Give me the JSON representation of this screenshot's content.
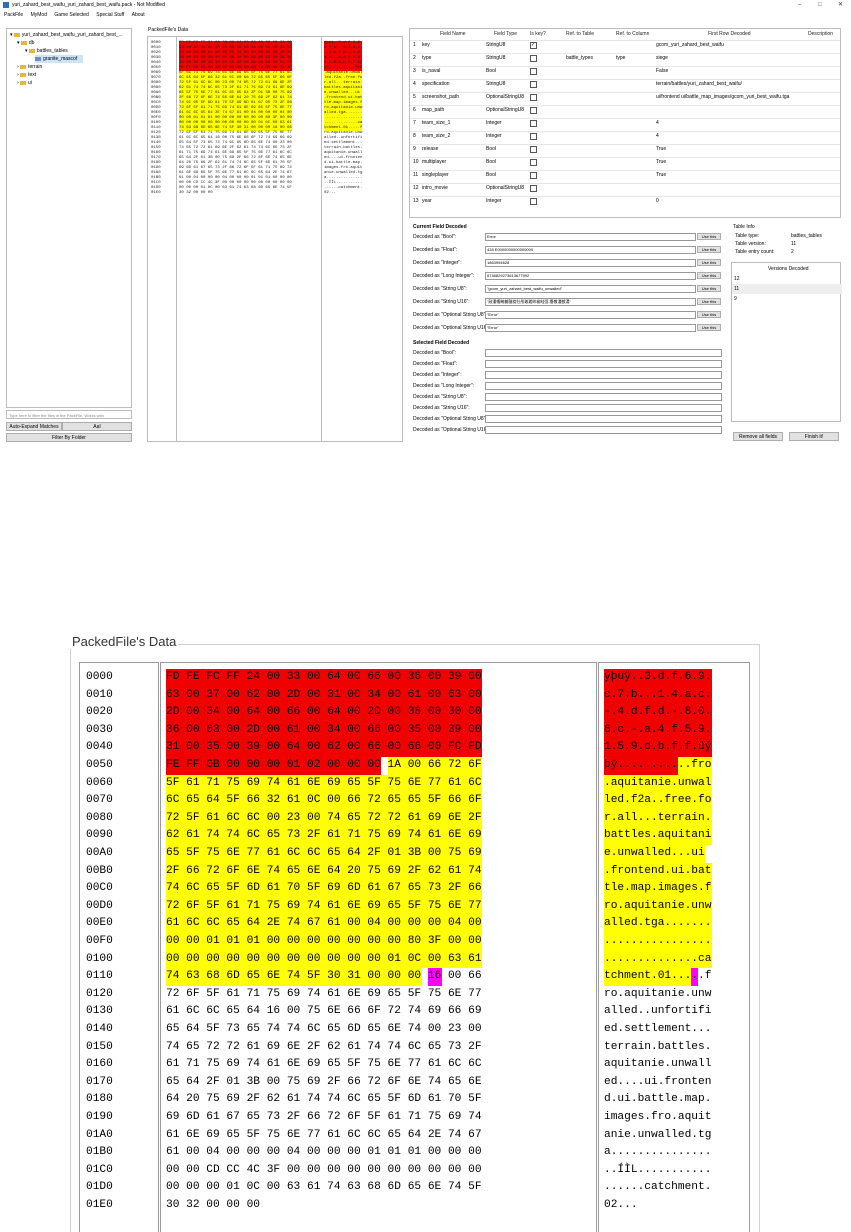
{
  "window": {
    "title": "yuri_zahard_best_waifu_yuri_zahard_best_waifu.pack - Not Modified",
    "minimize": "–",
    "maximize": "□",
    "close": "✕"
  },
  "menu": [
    "PackFile",
    "MyMod",
    "Game Selected",
    "Special Stuff",
    "About"
  ],
  "tree": {
    "root": "yuri_zahard_best_waifu_yuri_zahard_best_...",
    "items": [
      "db",
      "battles_tables",
      "granite_mascof",
      "terrain",
      "text",
      "ui"
    ],
    "filter_placeholder": "Type here to filter the files in the PackFile. Works with",
    "auto_expand_label": "Auto-Expand Matches",
    "case_label": "AaI",
    "filter_folder_label": "Filter By Folder"
  },
  "packed_small_label": "PackedFile's Data",
  "grid": {
    "headers": [
      "Field Name",
      "Field Type",
      "Is key?",
      "Ref. to Table",
      "Ref. to Column",
      "First Row Decoded",
      "Description"
    ],
    "rows": [
      {
        "n": "1",
        "name": "key",
        "type": "StringU8",
        "key": true,
        "ref_table": "",
        "ref_col": "",
        "first": "gcom_yuri_zahard_best_waifu"
      },
      {
        "n": "2",
        "name": "type",
        "type": "StringU8",
        "key": false,
        "ref_table": "battle_types",
        "ref_col": "type",
        "first": "siege"
      },
      {
        "n": "3",
        "name": "is_naval",
        "type": "Bool",
        "key": false,
        "ref_table": "",
        "ref_col": "",
        "first": "False"
      },
      {
        "n": "4",
        "name": "specification",
        "type": "StringU8",
        "key": false,
        "ref_table": "",
        "ref_col": "",
        "first": "terrain/battles/yuri_zahard_best_waifu/"
      },
      {
        "n": "5",
        "name": "screenshot_path",
        "type": "OptionalStringU8",
        "key": false,
        "ref_table": "",
        "ref_col": "",
        "first": "ui/frontend ui/battle_map_images/gcom_yuri_best_waifu.tga"
      },
      {
        "n": "6",
        "name": "map_path",
        "type": "OptionalStringU8",
        "key": false,
        "ref_table": "",
        "ref_col": "",
        "first": ""
      },
      {
        "n": "7",
        "name": "team_size_1",
        "type": "Integer",
        "key": false,
        "ref_table": "",
        "ref_col": "",
        "first": "4"
      },
      {
        "n": "8",
        "name": "team_size_2",
        "type": "Integer",
        "key": false,
        "ref_table": "",
        "ref_col": "",
        "first": "4"
      },
      {
        "n": "9",
        "name": "release",
        "type": "Bool",
        "key": false,
        "ref_table": "",
        "ref_col": "",
        "first": "True"
      },
      {
        "n": "10",
        "name": "multiplayer",
        "type": "Bool",
        "key": false,
        "ref_table": "",
        "ref_col": "",
        "first": "True"
      },
      {
        "n": "11",
        "name": "singleplayer",
        "type": "Bool",
        "key": false,
        "ref_table": "",
        "ref_col": "",
        "first": "True"
      },
      {
        "n": "12",
        "name": "intro_movie",
        "type": "OptionalStringU8",
        "key": false,
        "ref_table": "",
        "ref_col": "",
        "first": ""
      },
      {
        "n": "13",
        "name": "year",
        "type": "Integer",
        "key": false,
        "ref_table": "",
        "ref_col": "",
        "first": "0"
      }
    ]
  },
  "decoder": {
    "current_label": "Current Field Decoded",
    "current": [
      {
        "label": "Decoded as \"Bool\":",
        "value": "Error"
      },
      {
        "label": "Decoded as \"Float\":",
        "value": "428 E0000000000000000"
      },
      {
        "label": "Decoded as \"Integer\":",
        "value": "1863994628"
      },
      {
        "label": "Decoded as \"Long Integer\":",
        "value": "8746829273613677992"
      },
      {
        "label": "Decoded as \"String U8\":",
        "value": "\"gcom_yuri_zahard_best_waifu_unwalled\""
      },
      {
        "label": "Decoded as \"String U16\":",
        "value": "\"敲湩㡧畹楲穟桡牡彤敢瑳睟楡畦弳⸳㨱敬湩獣湯\""
      },
      {
        "label": "Decoded as \"Optional String U8\":",
        "value": "\"Error\""
      },
      {
        "label": "Decoded as \"Optional String U16\":",
        "value": "\"Error\""
      }
    ],
    "use_label": "Use this",
    "selected_label": "Selected Field Decoded",
    "selected": [
      "Decoded as \"Bool\":",
      "Decoded as \"Float\":",
      "Decoded as \"Integer\":",
      "Decoded as \"Long Integer\":",
      "Decoded as \"String U8\":",
      "Decoded as \"String U16\":",
      "Decoded as \"Optional String U8\":",
      "Decoded as \"Optional String U16\":"
    ]
  },
  "table_info": {
    "title": "Table Info",
    "type_label": "Table type:",
    "type_value": "battles_tables",
    "version_label": "Table version:",
    "version_value": "11",
    "count_label": "Table entry count:",
    "count_value": "2",
    "versions_title": "Versions Decoded",
    "versions": [
      "12",
      "11",
      "9"
    ],
    "remove_label": "Remove all fields",
    "finish_label": "Finish it!"
  },
  "zoom_title": "PackedFile's Data",
  "hex_lines": [
    {
      "off": "0000",
      "hex": "FD FE FC FF 24 00 33 00 64 00 66 00 36 00 39 00",
      "asc": "ýþüÿ..3.d.f.6.9."
    },
    {
      "off": "0010",
      "hex": "63 00 37 00 62 00 2D 00 31 00 34 00 61 00 63 00",
      "asc": "c.7.b...1.4.a.c."
    },
    {
      "off": "0020",
      "hex": "2D 00 34 00 64 00 66 00 64 00 2D 00 38 00 30 00",
      "asc": "-.4.d.f.d.-.8.0."
    },
    {
      "off": "0030",
      "hex": "36 00 63 00 2D 00 61 00 34 00 66 00 35 00 39 00",
      "asc": "6.c.-.a.4.f.5.9."
    },
    {
      "off": "0040",
      "hex": "31 00 35 00 39 00 64 00 62 00 66 00 66 00 FC FD",
      "asc": "1.5.9.d.b.f.f.üý"
    },
    {
      "off": "0050",
      "hex": "FE FF 0B 00 00 00 01 02 00 00 00 1A 00 66 72 6F",
      "asc": "þÿ...........fro"
    },
    {
      "off": "0060",
      "hex": "5F 61 71 75 69 74 61 6E 69 65 5F 75 6E 77 61 6C",
      "asc": ".aquitanie.unwal"
    },
    {
      "off": "0070",
      "hex": "6C 65 64 5F 66 32 61 0C 00 66 72 65 65 5F 66 6F",
      "asc": "led.f2a..free.fo"
    },
    {
      "off": "0080",
      "hex": "72 5F 61 6C 6C 00 23 00 74 65 72 72 61 69 6E 2F",
      "asc": "r.all...terrain."
    },
    {
      "off": "0090",
      "hex": "62 61 74 74 6C 65 73 2F 61 71 75 69 74 61 6E 69",
      "asc": "battles.aquitani"
    },
    {
      "off": "00A0",
      "hex": "65 5F 75 6E 77 61 6C 6C 65 64 2F 01 3B 00 75 69",
      "asc": "e.unwalled...ui"
    },
    {
      "off": "00B0",
      "hex": "2F 66 72 6F 6E 74 65 6E 64 20 75 69 2F 62 61 74",
      "asc": ".frontend.ui.bat"
    },
    {
      "off": "00C0",
      "hex": "74 6C 65 5F 6D 61 70 5F 69 6D 61 67 65 73 2F 66",
      "asc": "tle.map.images.f"
    },
    {
      "off": "00D0",
      "hex": "72 6F 5F 61 71 75 69 74 61 6E 69 65 5F 75 6E 77",
      "asc": "ro.aquitanie.unw"
    },
    {
      "off": "00E0",
      "hex": "61 6C 6C 65 64 2E 74 67 61 00 04 00 00 00 04 00",
      "asc": "alled.tga......."
    },
    {
      "off": "00F0",
      "hex": "00 00 01 01 01 00 00 00 00 00 00 00 80 3F 00 00",
      "asc": "................"
    },
    {
      "off": "0100",
      "hex": "00 00 00 00 00 00 00 00 00 00 00 01 0C 00 63 61",
      "asc": "..............ca"
    },
    {
      "off": "0110",
      "hex": "74 63 68 6D 65 6E 74 5F 30 31 00 00 00 16 00 66",
      "asc": "tchment.01.....f"
    },
    {
      "off": "0120",
      "hex": "72 6F 5F 61 71 75 69 74 61 6E 69 65 5F 75 6E 77",
      "asc": "ro.aquitanie.unw"
    },
    {
      "off": "0130",
      "hex": "61 6C 6C 65 64 16 00 75 6E 66 6F 72 74 69 66 69",
      "asc": "alled..unfortifi"
    },
    {
      "off": "0140",
      "hex": "65 64 5F 73 65 74 74 6C 65 6D 65 6E 74 00 23 00",
      "asc": "ed.settlement..."
    },
    {
      "off": "0150",
      "hex": "74 65 72 72 61 69 6E 2F 62 61 74 74 6C 65 73 2F",
      "asc": "terrain.battles."
    },
    {
      "off": "0160",
      "hex": "61 71 75 69 74 61 6E 69 65 5F 75 6E 77 61 6C 6C",
      "asc": "aquitanie.unwall"
    },
    {
      "off": "0170",
      "hex": "65 64 2F 01 3B 00 75 69 2F 66 72 6F 6E 74 65 6E",
      "asc": "ed....ui.fronten"
    },
    {
      "off": "0180",
      "hex": "64 20 75 69 2F 62 61 74 74 6C 65 5F 6D 61 70 5F",
      "asc": "d.ui.battle.map."
    },
    {
      "off": "0190",
      "hex": "69 6D 61 67 65 73 2F 66 72 6F 5F 61 71 75 69 74",
      "asc": "images.fro.aquit"
    },
    {
      "off": "01A0",
      "hex": "61 6E 69 65 5F 75 6E 77 61 6C 6C 65 64 2E 74 67",
      "asc": "anie.unwalled.tg"
    },
    {
      "off": "01B0",
      "hex": "61 00 04 00 00 00 04 00 00 00 01 01 01 00 00 00",
      "asc": "a..............."
    },
    {
      "off": "01C0",
      "hex": "00 00 CD CC 4C 3F 00 00 00 00 00 00 00 00 00 00",
      "asc": "..ÍÌL..........."
    },
    {
      "off": "01D0",
      "hex": "00 00 00 01 0C 00 63 61 74 63 68 6D 65 6E 74 5F",
      "asc": "......catchment."
    },
    {
      "off": "01E0",
      "hex": "30 32 00 00 00",
      "asc": "02..."
    }
  ],
  "highlight": {
    "red_until_byte": 91,
    "yellow_until_byte": 285,
    "magenta_byte": 285,
    "red_color": "#f00000",
    "yellow_color": "#ffff00",
    "magenta_color": "#ff00ff"
  }
}
